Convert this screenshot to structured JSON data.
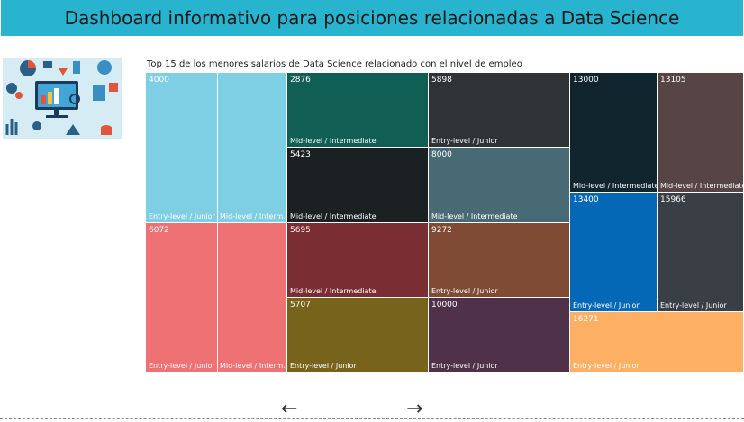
{
  "header": {
    "title": "Dashboard informativo para posiciones relacionadas a Data Science"
  },
  "chart_title": "Top 15 de los menores salarios de Data Science relacionado con el nivel de empleo",
  "chart_data": {
    "type": "treemap",
    "title": "Top 15 de los menores salarios de Data Science relacionado con el nivel de empleo",
    "groups": [
      {
        "value": "4000",
        "labels": [
          "Entry-level / Junior",
          "Mid-level / Interm..."
        ]
      },
      {
        "value": "6072",
        "labels": [
          "Entry-level / Junior",
          "Mid-level / Interm..."
        ]
      },
      {
        "value": "2876",
        "labels": [
          "Mid-level / Intermediate"
        ]
      },
      {
        "value": "5423",
        "labels": [
          "Mid-level / Intermediate"
        ]
      },
      {
        "value": "5695",
        "labels": [
          "Mid-level / Intermediate"
        ]
      },
      {
        "value": "5707",
        "labels": [
          "Entry-level / Junior"
        ]
      },
      {
        "value": "5898",
        "labels": [
          "Entry-level / Junior"
        ]
      },
      {
        "value": "8000",
        "labels": [
          "Mid-level / Intermediate"
        ]
      },
      {
        "value": "9272",
        "labels": [
          "Entry-level / Junior"
        ]
      },
      {
        "value": "10000",
        "labels": [
          "Entry-level / Junior"
        ]
      },
      {
        "value": "13000",
        "labels": [
          "Mid-level / Intermediate"
        ]
      },
      {
        "value": "13105",
        "labels": [
          "Mid-level / Intermediate"
        ]
      },
      {
        "value": "13400",
        "labels": [
          "Entry-level / Junior"
        ]
      },
      {
        "value": "15966",
        "labels": [
          "Entry-level / Junior"
        ]
      },
      {
        "value": "16271",
        "labels": [
          "Entry-level / Junior"
        ]
      }
    ],
    "colors": {
      "4000": "#7ecfe3",
      "6072": "#ee7274",
      "2876": "#115e55",
      "5423": "#1b2123",
      "5695": "#7a2e33",
      "5707": "#78631c",
      "5898": "#2f3336",
      "8000": "#486a75",
      "9272": "#7f4b35",
      "10000": "#4f314a",
      "13000": "#10252d",
      "13105": "#574545",
      "13400": "#0568b7",
      "15966": "#3a3e45",
      "16271": "#fdb064"
    }
  },
  "nav": {
    "prev_icon": "←",
    "next_icon": "→"
  }
}
